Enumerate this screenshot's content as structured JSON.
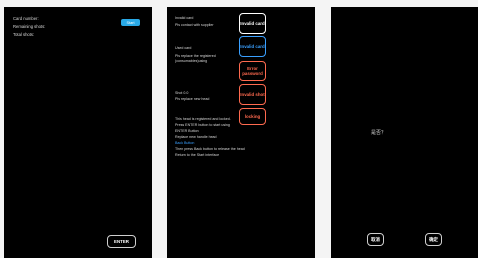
{
  "screen1": {
    "card_number_label": "Card number:",
    "remaining_shots_label": "Remaining shots:",
    "total_shots_label": "Total shots:",
    "chip_label": "Start",
    "enter_button": "ENTER"
  },
  "screen2": {
    "error1": {
      "title": "Invalid card",
      "hint": "Pls contact with supplier",
      "button": "Invalid card"
    },
    "error2": {
      "title": "Used card",
      "hint_line1": "Pls replace the registered",
      "hint_line2": "(consumables)using",
      "button": "Invalid card"
    },
    "error3": {
      "button": "Error password"
    },
    "error4": {
      "title": "Shot 0.0",
      "hint": "Pls replace new head",
      "button": "Invalid shot"
    },
    "error5": {
      "button": "locking"
    },
    "footer_lines": [
      "This head is registered and locked.",
      "Press ENTER button to start using",
      "ENTER        Button",
      "Replace new handle head",
      "Back        Button",
      "Then press Back button to release the head",
      "Return to the Start interface"
    ],
    "colors": {
      "red": "#ff6a4f",
      "blue": "#3aa0ff",
      "white": "#ffffff"
    }
  },
  "screen3": {
    "center_text": "是否？",
    "left_button": "取消",
    "right_button": "确定"
  }
}
